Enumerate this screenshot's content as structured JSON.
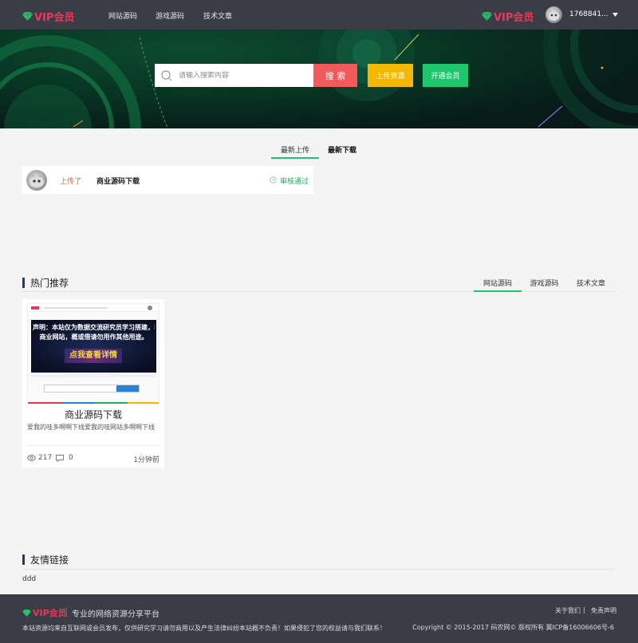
{
  "topbar": {
    "logo_text": "VIP会员",
    "nav": [
      "网站源码",
      "游戏源码",
      "技术文章"
    ],
    "vip_text": "VIP会员",
    "username": "1768841..."
  },
  "search": {
    "placeholder": "请输入搜索内容",
    "button": "搜 索",
    "upload_button": "上传资源",
    "vip_button": "开通会员"
  },
  "upload_tabs": [
    "最新上传",
    "最新下载"
  ],
  "activity": {
    "action": "上传了",
    "title": "商业源码下载",
    "status": "审核通过"
  },
  "hot": {
    "title": "热门推荐",
    "tabs": [
      "网站源码",
      "游戏源码",
      "技术文章"
    ],
    "card": {
      "thumb_text_line1": "声明：本站仅为数据交流研究员学习搭建，非服",
      "thumb_text_line2": "商业网站，概或借请勿用作其他用途。",
      "thumb_button": "点我查看详情",
      "title": "商业源码下载",
      "desc": "爱我的哇多啊啊下线爱我的哇网站多啊啊下线",
      "views": "217",
      "comments": "0",
      "time": "1分钟前"
    }
  },
  "links": {
    "title": "友情链接",
    "items": [
      "ddd"
    ]
  },
  "footer": {
    "logo_text": "VIP会员",
    "slogan": "专业的网络资源分享平台",
    "about": "关于我们",
    "sep": "|",
    "disclaimer": "免责声明",
    "notice": "本站资源均来自互联网或会员发布，仅供研究学习请勿商用以及产生法律纠纷本站概不负责！如果侵犯了您的权益请与我们联系！",
    "copyright": "Copyright © 2015-2017 码农网© 版权所有 冀ICP备16006606号-6"
  },
  "colors": {
    "accent_red": "#e8395a",
    "search_button": "#f05a5a",
    "upload_button": "#f5b800",
    "vip_button": "#1ec66d",
    "tab_underline": "#1ec66d"
  }
}
